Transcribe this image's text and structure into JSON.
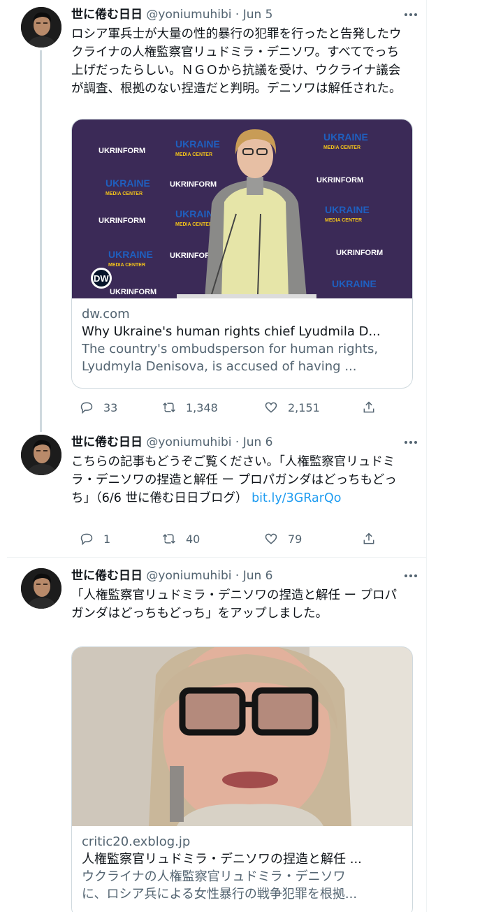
{
  "tweets": [
    {
      "name": "世に倦む日日",
      "handle": "@yoniumuhibi",
      "dot": " · ",
      "date": "Jun 5",
      "text": "ロシア軍兵士が大量の性的暴行の犯罪を行ったと告発したウクライナの人権監察官リュドミラ・デニソワ。すべてでっち上げだったらしい。ＮＧＯから抗議を受け、ウクライナ議会が調査、根拠のない捏造だと判明。デニソワは解任された。",
      "card": {
        "domain": "dw.com",
        "title": "Why Ukraine's human rights chief Lyudmila D...",
        "description": "The country's ombudsperson for human rights, Lyudmyla Denisova, is accused of having ...",
        "image_texts": {
          "ukrinform": "UKRINFORM",
          "ukraine": "UKRAINE",
          "media_center": "MEDIA CENTER",
          "logo": "DW"
        }
      },
      "replies": "33",
      "retweets": "1,348",
      "likes": "2,151"
    },
    {
      "name": "世に倦む日日",
      "handle": "@yoniumuhibi",
      "dot": " · ",
      "date": "Jun 6",
      "text": "こちらの記事もどうぞご覧ください。「人権監察官リュドミラ・デニソワの捏造と解任 ー プロパガンダはどっちもどっち」（6/6 世に倦む日日ブログ）",
      "link": "bit.ly/3GRarQo",
      "replies": "1",
      "retweets": "40",
      "likes": "79"
    },
    {
      "name": "世に倦む日日",
      "handle": "@yoniumuhibi",
      "dot": " · ",
      "date": "Jun 6",
      "text": "「人権監察官リュドミラ・デニソワの捏造と解任 ー プロパガンダはどっちもどっち」をアップしました。",
      "card": {
        "domain": "critic20.exblog.jp",
        "title": "人権監察官リュドミラ・デニソワの捏造と解任 ...",
        "description_line1": "ウクライナの人権監察官リュドミラ・デニソワ",
        "description_line2": "に、ロシア兵による女性暴行の戦争犯罪を根拠..."
      }
    }
  ],
  "colors": {
    "text": "#0f1419",
    "secondary": "#536471",
    "link": "#1d9bf0",
    "border": "#cfd9de",
    "backdrop": "#3b2a57",
    "logo_yellow": "#f2c21b",
    "logo_blue": "#1f5fbf"
  },
  "icons": [
    "avatar",
    "more-icon",
    "reply-icon",
    "retweet-icon",
    "like-icon",
    "share-icon"
  ]
}
